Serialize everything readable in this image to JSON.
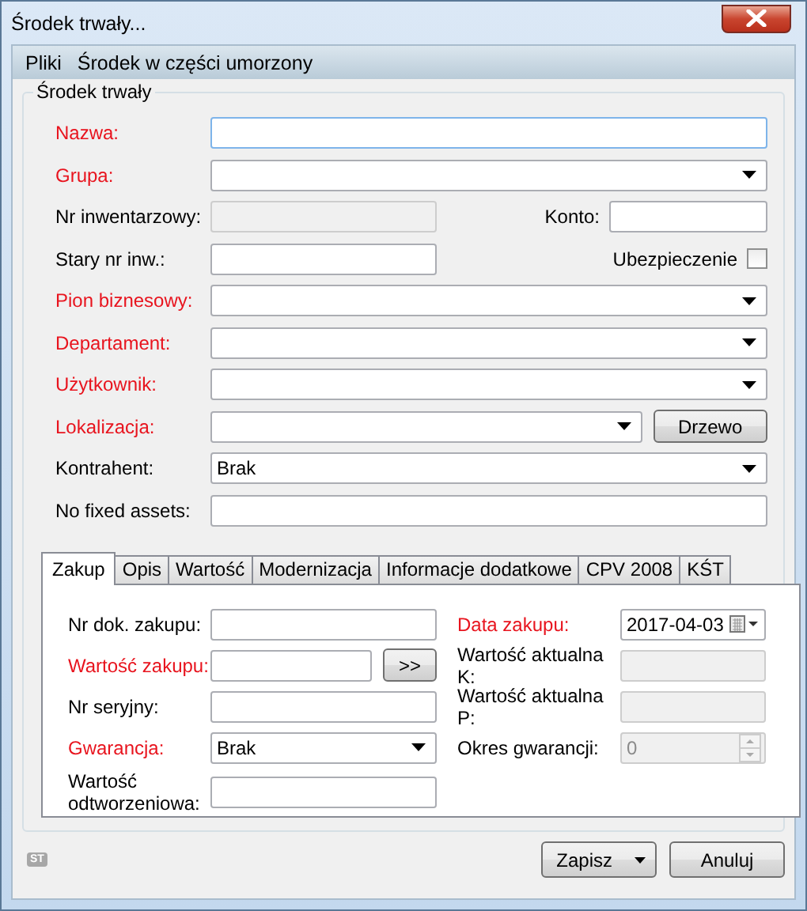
{
  "window": {
    "title": "Środek trwały..."
  },
  "menu": [
    {
      "label": "Pliki"
    },
    {
      "label": "Środek w części umorzony"
    }
  ],
  "group": {
    "title": "Środek trwały",
    "rows": [
      {
        "label": "Nazwa:",
        "required": true,
        "field": {
          "kind": "text",
          "disabled": false
        }
      },
      {
        "label": "Grupa:",
        "required": true,
        "field": {
          "kind": "combo",
          "disabled": false
        }
      },
      {
        "label": "Nr inwentarzowy:",
        "required": false,
        "field": {
          "kind": "short",
          "disabled": true
        },
        "extra": {
          "kind": "field",
          "label": "Konto:"
        }
      },
      {
        "label": "Stary nr inw.:",
        "required": false,
        "field": {
          "kind": "short",
          "disabled": false
        },
        "extra": {
          "kind": "checkbox",
          "label": "Ubezpieczenie",
          "checked": false
        }
      },
      {
        "label": "Pion biznesowy:",
        "required": true,
        "field": {
          "kind": "combo",
          "disabled": false
        }
      },
      {
        "label": "Departament:",
        "required": true,
        "field": {
          "kind": "combo",
          "disabled": false
        }
      },
      {
        "label": "Użytkownik:",
        "required": true,
        "field": {
          "kind": "combo",
          "disabled": false
        }
      },
      {
        "label": "Lokalizacja:",
        "required": true,
        "field": {
          "kind": "combo",
          "disabled": false
        },
        "extra": {
          "kind": "button",
          "label": "Drzewo"
        }
      },
      {
        "label": "Kontrahent:",
        "required": false,
        "field": {
          "kind": "combo",
          "disabled": false,
          "value": "Brak"
        }
      },
      {
        "label": "No fixed assets:",
        "required": false,
        "field": {
          "kind": "text",
          "disabled": false
        }
      }
    ]
  },
  "tabs": [
    {
      "label": "Zakup",
      "selected": true
    },
    {
      "label": "Opis",
      "selected": false
    },
    {
      "label": "Wartość",
      "selected": false
    },
    {
      "label": "Modernizacja",
      "selected": false
    },
    {
      "label": "Informacje dodatkowe",
      "selected": false
    },
    {
      "label": "CPV 2008",
      "selected": false
    },
    {
      "label": "KŚT",
      "selected": false
    }
  ],
  "tab_panel": {
    "left": [
      {
        "label": "Nr dok. zakupu:",
        "required": false,
        "kind": "text",
        "disabled": false
      },
      {
        "label": "Wartość zakupu:",
        "required": true,
        "kind": "text_button",
        "disabled": false,
        "button": ">>"
      },
      {
        "label": "Nr seryjny:",
        "required": false,
        "kind": "text",
        "disabled": false
      },
      {
        "label": "Gwarancja:",
        "required": true,
        "kind": "combo",
        "disabled": false,
        "value": "Brak"
      },
      {
        "label": "Wartość odtworzeniowa:",
        "required": false,
        "kind": "text",
        "disabled": false
      }
    ],
    "right": [
      {
        "label": "Data zakupu:",
        "required": true,
        "kind": "date",
        "disabled": false,
        "value": "2017-04-03"
      },
      {
        "label": "Wartość aktualna K:",
        "required": false,
        "kind": "text",
        "disabled": true
      },
      {
        "label": "Wartość aktualna P:",
        "required": false,
        "kind": "text",
        "disabled": true
      },
      {
        "label": "Okres gwarancji:",
        "required": false,
        "kind": "spin",
        "disabled": true,
        "value": "0"
      }
    ]
  },
  "footer": {
    "badge": "ST",
    "buttons": [
      {
        "label": "Zapisz",
        "kind": "split"
      },
      {
        "label": "Anuluj",
        "kind": "plain"
      }
    ]
  }
}
